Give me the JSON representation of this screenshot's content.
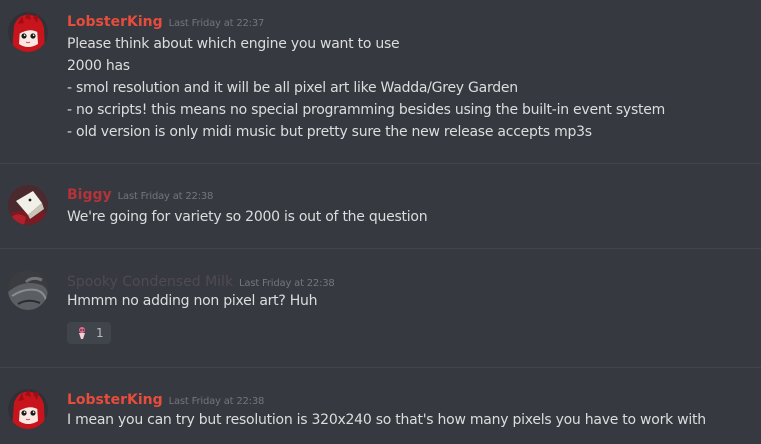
{
  "colors": {
    "background": "#36393f",
    "divider": "#41444a",
    "text": "#dcddde",
    "timestamp": "#72767d",
    "reaction_bg": "#40444b"
  },
  "messages": [
    {
      "username": "LobsterKing",
      "username_color": "#e74c3c",
      "avatar_icon": "red-haired-anime-avatar-icon",
      "timestamp": "Last Friday at 22:37",
      "lines": [
        "Please think about which engine you want to use",
        "2000 has",
        "- smol resolution and it will be all pixel art like Wadda/Grey Garden",
        "- no scripts! this means no special programming besides using the built-in event system",
        "- old version is only midi music but pretty sure the new release accepts mp3s"
      ]
    },
    {
      "username": "Biggy",
      "username_color": "#b4333a",
      "avatar_icon": "red-figure-avatar-icon",
      "timestamp": "Last Friday at 22:38",
      "lines": [
        "We're going for variety so 2000 is out of the question"
      ]
    },
    {
      "username": "Spooky Condensed Milk",
      "username_color": "#4f4a54",
      "avatar_icon": "gray-sketch-avatar-icon",
      "timestamp": "Last Friday at 22:38",
      "lines": [
        "Hmmm no adding non pixel art? Huh"
      ],
      "reaction": {
        "emoji_icon": "custom-character-emoji-icon",
        "count": "1"
      }
    },
    {
      "username": "LobsterKing",
      "username_color": "#e74c3c",
      "avatar_icon": "red-haired-anime-avatar-icon",
      "timestamp": "Last Friday at 22:38",
      "lines": [
        "I mean you can try but resolution is 320x240 so that's how many pixels you have to work with"
      ]
    }
  ]
}
